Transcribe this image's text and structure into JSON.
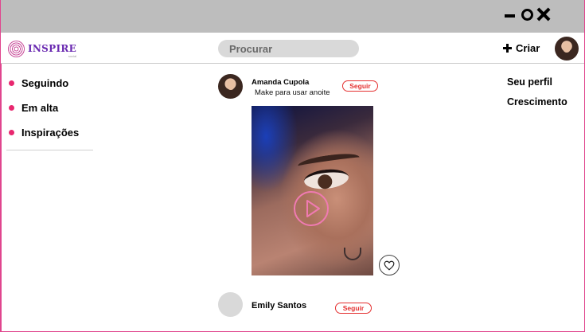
{
  "window": {
    "controls": [
      "minimize-icon",
      "maximize-icon",
      "close-icon"
    ]
  },
  "header": {
    "brand": "INSPIRE",
    "brand_tagline": "social",
    "search_placeholder": "Procurar",
    "create_label": "Criar"
  },
  "sidebar": {
    "items": [
      {
        "label": "Seguindo"
      },
      {
        "label": "Em alta"
      },
      {
        "label": "Inspirações"
      }
    ]
  },
  "right_menu": {
    "items": [
      {
        "label": "Seu perfil"
      },
      {
        "label": "Crescimento"
      }
    ]
  },
  "feed": {
    "posts": [
      {
        "author": "Amanda Cupola",
        "caption": "Make para usar anoite",
        "follow_label": "Seguir"
      },
      {
        "author": "Emily Santos",
        "follow_label": "Seguir"
      }
    ]
  },
  "colors": {
    "accent": "#e8286f",
    "follow": "#e42f2f",
    "brand": "#6a2ab1",
    "titlebar": "#bdbdbd",
    "search_bg": "#d9d9d9"
  }
}
